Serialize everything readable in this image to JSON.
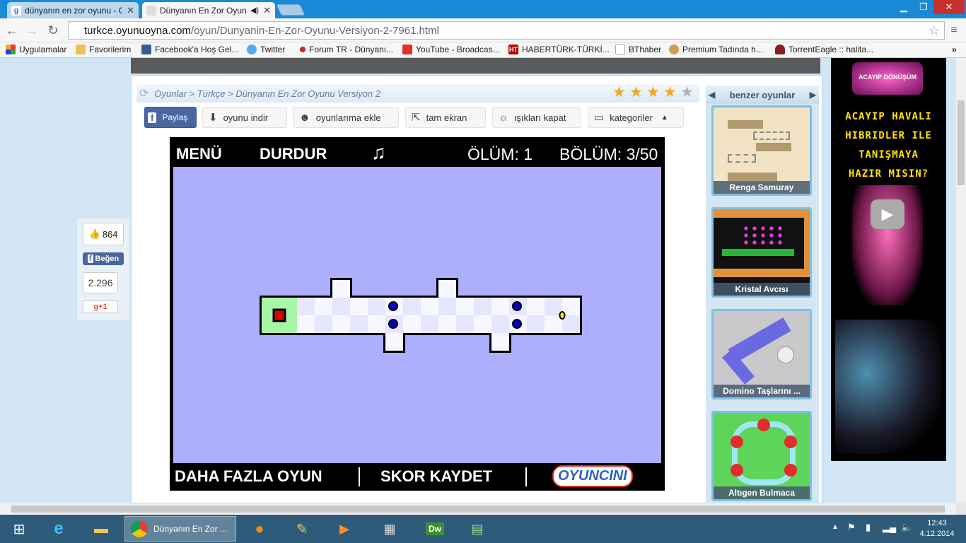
{
  "browser": {
    "tabs": [
      {
        "title": "dünyanın en zor oyunu - G"
      },
      {
        "title": "Dünyanın En Zor Oyun"
      }
    ],
    "url_host": "turkce.oyunuoyna.com",
    "url_path": "/oyun/Dunyanin-En-Zor-Oyunu-Versiyon-2-7961.html",
    "bookmarks": [
      {
        "label": "Uygulamalar"
      },
      {
        "label": "Favorilerim"
      },
      {
        "label": "Facebook'a Hoş Gel..."
      },
      {
        "label": "Twitter"
      },
      {
        "label": "Forum TR - Dünyanı..."
      },
      {
        "label": "YouTube - Broadcas..."
      },
      {
        "label": "HABERTÜRK-TÜRKİ..."
      },
      {
        "label": "BThaber"
      },
      {
        "label": "Premium Tadında h..."
      },
      {
        "label": "TorrentEagle :: halita..."
      }
    ]
  },
  "breadcrumb": {
    "oyunlar": "Oyunlar",
    "sep1": ">",
    "turkce": "Türkçe",
    "sep2": ">",
    "game": "Dünyanın En Zor Oyunu Versiyon 2"
  },
  "rating": {
    "stars": 4,
    "max": 5
  },
  "toolbar": {
    "share": "Paylaş",
    "download": "oyunu indir",
    "add": "oyunlarıma ekle",
    "fullscreen": "tam ekran",
    "lights": "ışıkları kapat",
    "categories": "kategoriler"
  },
  "game": {
    "menu": "MENÜ",
    "pause": "DURDUR",
    "deaths": "ÖLÜM: 1",
    "level": "BÖLÜM: 3/50",
    "more_games": "DAHA FAZLA OYUN",
    "save_score": "SKOR KAYDET",
    "logo": "OYUNCINI"
  },
  "social": {
    "likes": "864",
    "like_label": "Beğen",
    "plus_count": "2.296",
    "plus_label": "g+1"
  },
  "sidebar": {
    "title": "benzer oyunlar",
    "games": [
      {
        "name": "Renga Samuray"
      },
      {
        "name": "Kristal Avcısı"
      },
      {
        "name": "Domino Taşlarını ..."
      },
      {
        "name": "Altıgen Bulmaca"
      }
    ]
  },
  "ad": {
    "line1": "ACAYIP HAVALI",
    "line2": "HIBRIDLER ILE",
    "line3": "TANIŞMAYA",
    "line4": "HAZIR MISIN?",
    "badge": "ACAYIP DÖNÜŞÜM"
  },
  "taskbar": {
    "active_window": "Dünyanın En Zor ...",
    "time": "12:43",
    "date": "4.12.2014"
  },
  "colors": {
    "tabstrip": "#1b8ad6",
    "game_bg": "#aeaeff",
    "player": "#e00000",
    "enemy": "#0000cc",
    "coin": "#ffee00",
    "start_zone": "#a7f5a7"
  }
}
